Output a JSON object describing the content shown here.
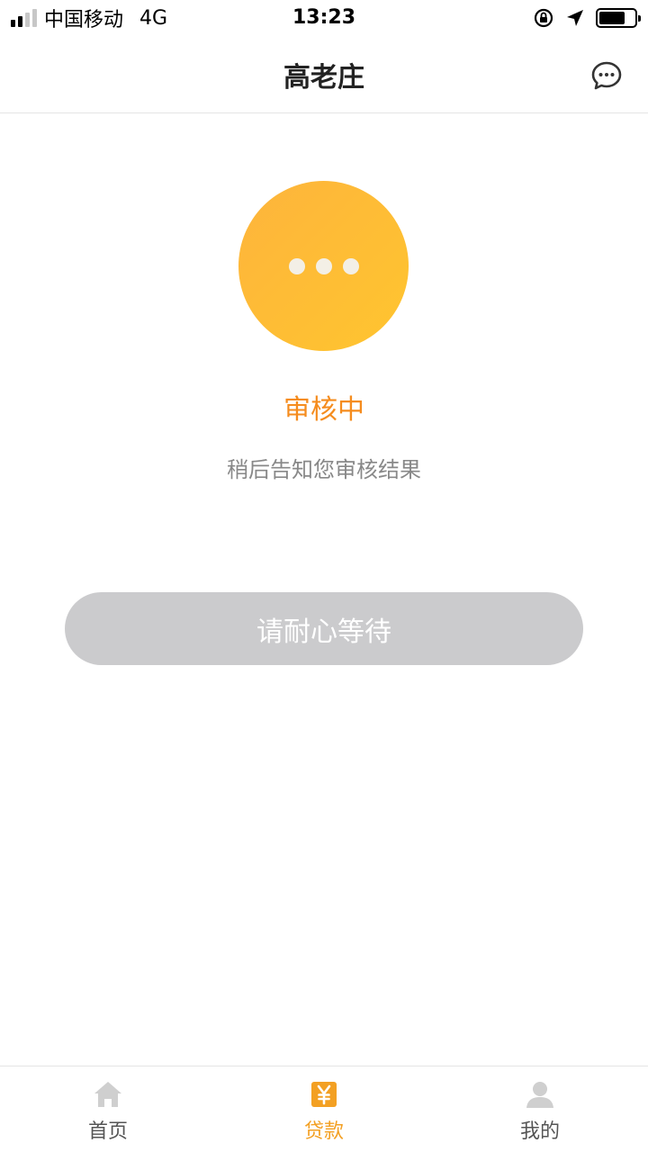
{
  "status_bar": {
    "carrier": "中国移动",
    "network": "4G",
    "time": "13:23"
  },
  "nav": {
    "title": "高老庄"
  },
  "review": {
    "title": "审核中",
    "description": "稍后告知您审核结果",
    "button_label": "请耐心等待"
  },
  "tabs": [
    {
      "label": "首页",
      "icon": "home-icon",
      "active": false
    },
    {
      "label": "贷款",
      "icon": "yuan-icon",
      "active": true
    },
    {
      "label": "我的",
      "icon": "user-icon",
      "active": false
    }
  ],
  "colors": {
    "accent": "#f3a023",
    "status_title": "#f58c1e",
    "circle_start": "#fdb43c",
    "circle_end": "#ffc52f",
    "button_disabled": "#cbcbcd"
  }
}
